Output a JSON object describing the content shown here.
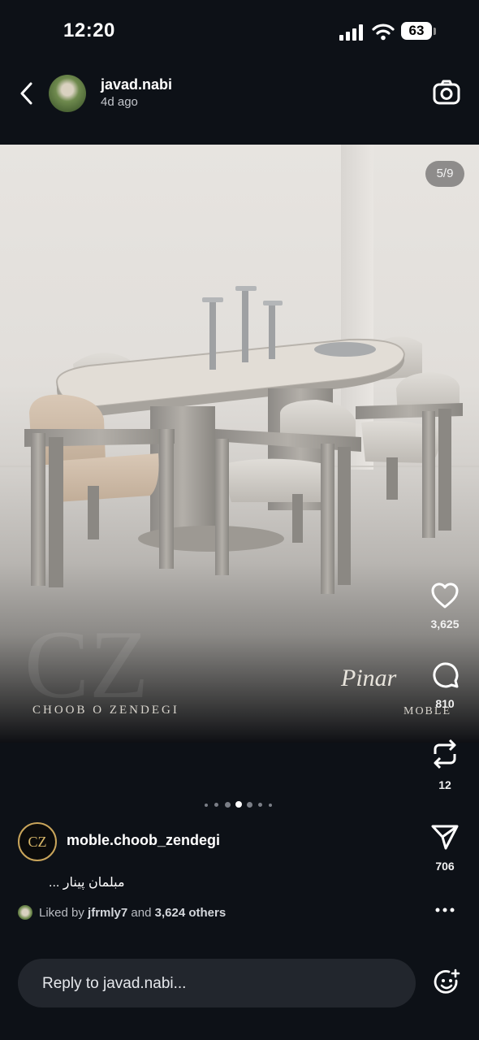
{
  "status_bar": {
    "time": "12:20",
    "battery": "63"
  },
  "header": {
    "username": "javad.nabi",
    "time_ago": "4d ago"
  },
  "post": {
    "image_counter": "5/9",
    "watermark_left": "CHOOB O ZENDEGI",
    "watermark_signature": "Pinar",
    "watermark_right": "MOBLE",
    "current_image": 5,
    "total_images": 9
  },
  "actions": {
    "likes": "3,625",
    "comments": "810",
    "reposts": "12",
    "shares": "706"
  },
  "caption": {
    "owner_username": "moble.choob_zendegi",
    "owner_avatar_text": "CZ",
    "text": "مبلمان پینار ..."
  },
  "liked_by": {
    "prefix": "Liked by",
    "user": "jfrmly7",
    "middle": "and",
    "others": "3,624 others"
  },
  "reply": {
    "placeholder": "Reply to javad.nabi..."
  },
  "icons": [
    "back-icon",
    "camera-icon",
    "heart-icon",
    "comment-icon",
    "repost-icon",
    "share-icon",
    "more-icon",
    "emoji-icon"
  ]
}
